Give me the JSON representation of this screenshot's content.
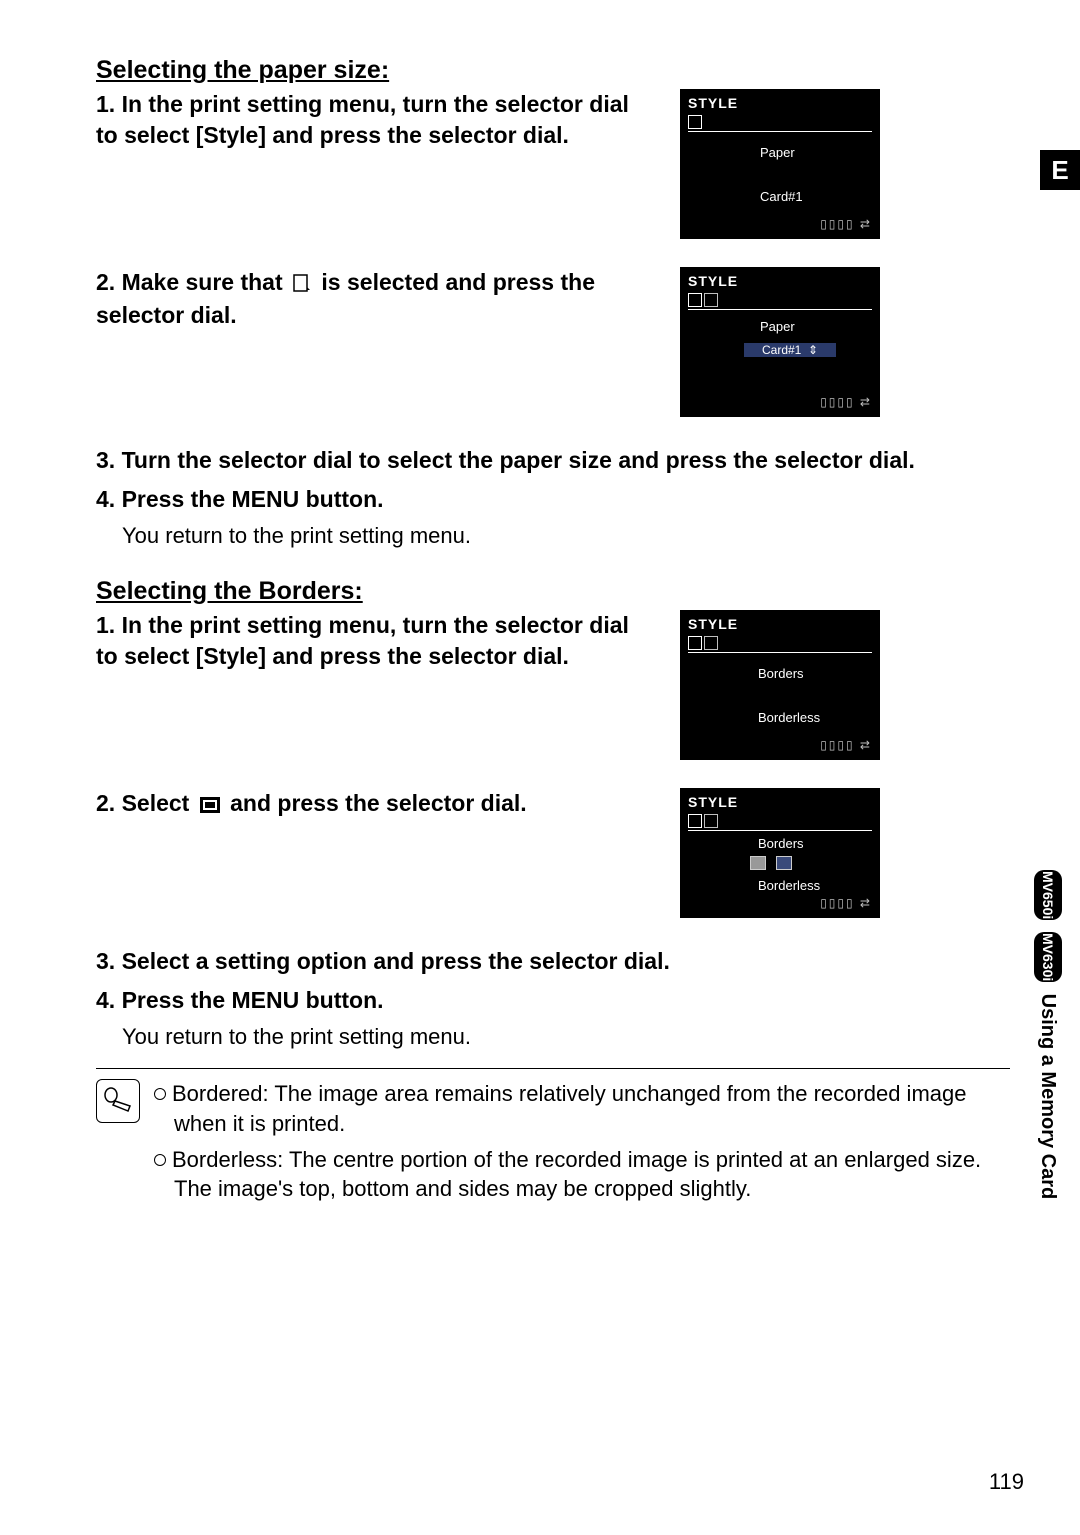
{
  "sideTab": "E",
  "sideText": "Using a Memory Card",
  "sidePill1": "MV650i",
  "sidePill2": "MV630i",
  "pageNumber": "119",
  "paperSize": {
    "heading": "Selecting the paper size:",
    "s1": "1. In the print setting menu, turn the selector dial to select [Style] and press the selector dial.",
    "s2a": "2. Make sure that ",
    "s2b": " is selected and press the selector dial.",
    "s3": "3. Turn the selector dial to select the paper size and press the selector dial.",
    "s4": "4. Press the MENU button.",
    "s4sub": "You return to the print setting menu."
  },
  "borders": {
    "heading": "Selecting the Borders:",
    "s1": "1. In the print setting menu, turn the selector dial to select [Style] and press the selector dial.",
    "s2a": "2. Select ",
    "s2b": " and press the selector dial.",
    "s3": "3. Select a setting option and press the selector dial.",
    "s4": "4. Press the MENU button.",
    "s4sub": "You return to the print setting menu."
  },
  "notes": {
    "n1": "Bordered: The image area remains relatively unchanged from the recorded image when it is printed.",
    "n2": "Borderless: The centre portion of the recorded image is printed at an enlarged size. The image's top, bottom and sides may be cropped slightly."
  },
  "shots": {
    "title": "STYLE",
    "paper": "Paper",
    "card": "Card#1",
    "borders": "Borders",
    "borderless": "Borderless"
  }
}
